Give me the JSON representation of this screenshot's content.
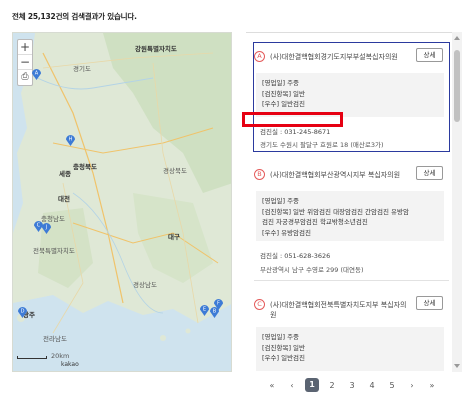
{
  "summary": {
    "prefix": "전체 ",
    "count": "25,132",
    "suffix": "건의 검색결과가 있습니다."
  },
  "map": {
    "labels": {
      "gangwon": "강원특별자치도",
      "chungbuk": "충청북도",
      "sejong": "세종",
      "daejeon": "대전",
      "jeonbuk": "전북특별자치도",
      "gyeongbuk": "경상북도",
      "daegu": "대구",
      "gyeongnam": "경상남도",
      "gwangju": "광주",
      "jeonnam": "전라남도",
      "chungnam": "충청남도",
      "gyeonggi": "경기도"
    },
    "pins": [
      "A",
      "B",
      "C",
      "D",
      "E",
      "F",
      "H",
      "J"
    ],
    "attribution": "kakao",
    "scale": "20km"
  },
  "results": [
    {
      "badge": "A",
      "title": "(사)대한결핵협회경기도지부부설복십자의원",
      "detail_label": "상세",
      "lines": [
        "[영업일] 주중",
        "[검진항목] 일반",
        "[우수] 일반검진"
      ],
      "phone": "검진실 : 031-245-8671",
      "address": "경기도 수원시 팔달구 효원로 18 (매산로3가)"
    },
    {
      "badge": "B",
      "title": "(사)대한결핵협회부산광역시지부 복십자의원",
      "detail_label": "상세",
      "lines": [
        "[영업일] 주중",
        "[검진항목] 일반 위암검진 대장암검진 간암검진 유방암",
        "검진 자궁경부암검진 학교밖청소년검진",
        "[우수] 유방암검진"
      ],
      "phone": "검진실 : 051-628-3626",
      "address": "부산광역시 남구 수영로 299 (대연동)"
    },
    {
      "badge": "C",
      "title": "(사)대한결핵협회전북특별자치도지부 복십자의원",
      "detail_label": "상세",
      "lines": [
        "[영업일] 주중",
        "[검진항목] 일반",
        "[우수] 일반검진"
      ],
      "phone": "",
      "address": ""
    }
  ],
  "pagination": {
    "first": "«",
    "prev": "‹",
    "pages": [
      "1",
      "2",
      "3",
      "4",
      "5"
    ],
    "current": "1",
    "next": "›",
    "last": "»"
  },
  "colors": {
    "highlight": "#e60012",
    "selected_border": "#2b3a9e",
    "badge": "#e45a5a",
    "pin": "#3d7bd6"
  }
}
